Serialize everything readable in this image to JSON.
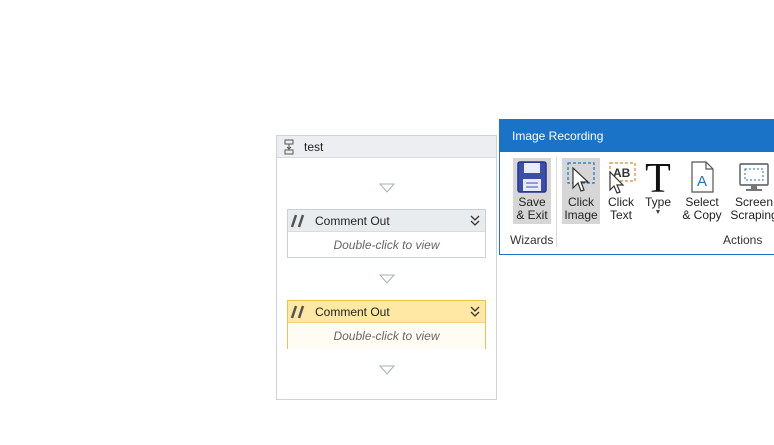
{
  "sequence": {
    "title": "test",
    "activities": [
      {
        "title": "Comment Out",
        "body": "Double-click to view"
      },
      {
        "title": "Comment Out",
        "body": "Double-click to view"
      }
    ]
  },
  "ribbon": {
    "title": "Image Recording",
    "buttons": {
      "save_exit": {
        "line1": "Save",
        "line2": "& Exit"
      },
      "click_image": {
        "line1": "Click",
        "line2": "Image"
      },
      "click_text": {
        "line1": "Click",
        "line2": "Text"
      },
      "type": {
        "line1": "Type"
      },
      "select_copy": {
        "line1": "Select",
        "line2": "& Copy"
      },
      "screen_scraping": {
        "line1": "Screen",
        "line2": "Scraping"
      }
    },
    "groups": {
      "wizards": "Wizards",
      "actions": "Actions"
    }
  },
  "colors": {
    "ribbon_title_bg": "#1a73c7",
    "selected_activity": "#ffe8a3",
    "accent": "#1a73c7"
  }
}
